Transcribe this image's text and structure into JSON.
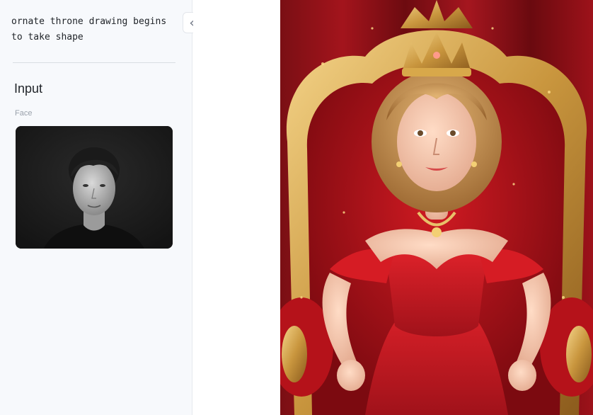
{
  "sidebar": {
    "prompt_text": "ornate throne drawing begins\nto take shape",
    "input_section_title": "Input",
    "face_label": "Face",
    "collapse_icon": "double-chevron-left-icon"
  },
  "result": {
    "image_name": "queen-on-throne-image"
  }
}
